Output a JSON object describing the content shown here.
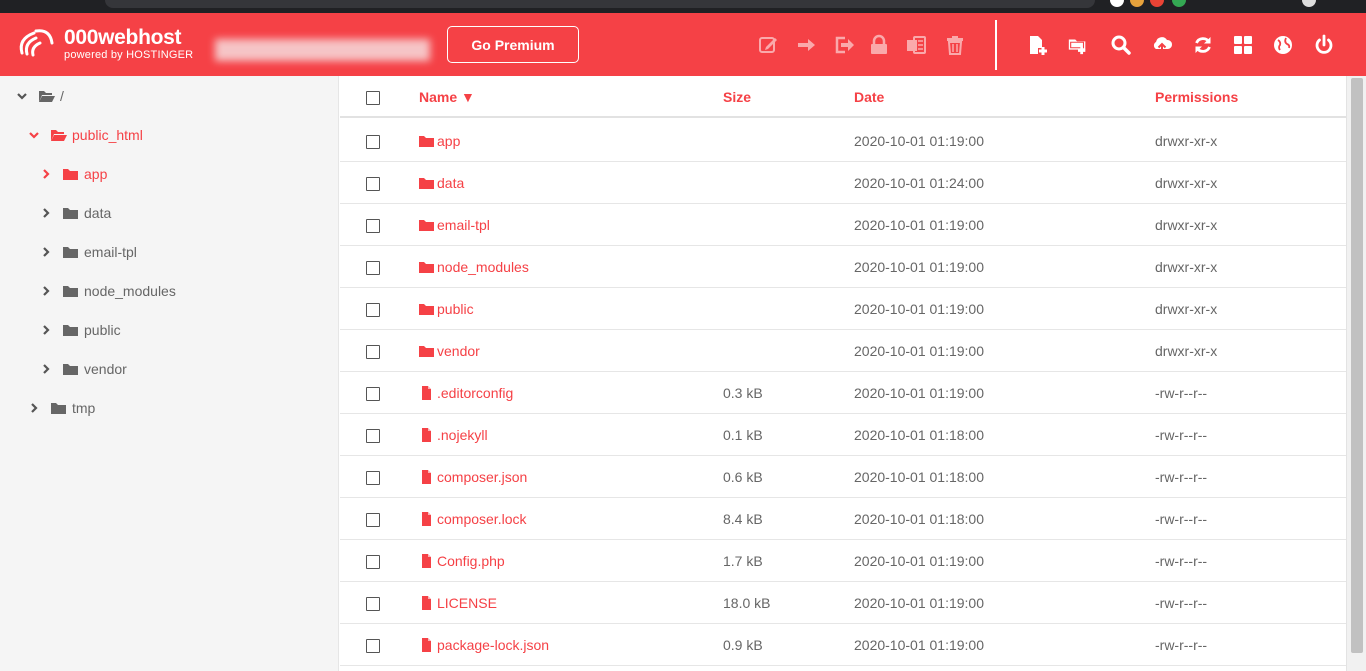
{
  "brand": {
    "name": "000webhost",
    "tagline": "powered by HOSTINGER"
  },
  "premium_button": "Go Premium",
  "toolbar": {
    "file_actions": [
      "edit-icon",
      "move-icon",
      "export-icon",
      "lock-icon",
      "archive-icon",
      "trash-icon"
    ],
    "global_actions": [
      "new-file-icon",
      "new-folder-icon",
      "search-icon",
      "upload-icon",
      "refresh-icon",
      "grid-view-icon",
      "globe-icon",
      "power-icon"
    ]
  },
  "tree": {
    "root": "/",
    "public_html": "public_html",
    "children": [
      "app",
      "data",
      "email-tpl",
      "node_modules",
      "public",
      "vendor"
    ],
    "tmp": "tmp"
  },
  "columns": {
    "name": "Name ▼",
    "size": "Size",
    "date": "Date",
    "permissions": "Permissions"
  },
  "files": [
    {
      "name": "app",
      "type": "folder",
      "size": "",
      "date": "2020-10-01 01:19:00",
      "perm": "drwxr-xr-x"
    },
    {
      "name": "data",
      "type": "folder",
      "size": "",
      "date": "2020-10-01 01:24:00",
      "perm": "drwxr-xr-x"
    },
    {
      "name": "email-tpl",
      "type": "folder",
      "size": "",
      "date": "2020-10-01 01:19:00",
      "perm": "drwxr-xr-x"
    },
    {
      "name": "node_modules",
      "type": "folder",
      "size": "",
      "date": "2020-10-01 01:19:00",
      "perm": "drwxr-xr-x"
    },
    {
      "name": "public",
      "type": "folder",
      "size": "",
      "date": "2020-10-01 01:19:00",
      "perm": "drwxr-xr-x"
    },
    {
      "name": "vendor",
      "type": "folder",
      "size": "",
      "date": "2020-10-01 01:19:00",
      "perm": "drwxr-xr-x"
    },
    {
      "name": ".editorconfig",
      "type": "file",
      "size": "0.3 kB",
      "date": "2020-10-01 01:19:00",
      "perm": "-rw-r--r--"
    },
    {
      "name": ".nojekyll",
      "type": "file",
      "size": "0.1 kB",
      "date": "2020-10-01 01:18:00",
      "perm": "-rw-r--r--"
    },
    {
      "name": "composer.json",
      "type": "file",
      "size": "0.6 kB",
      "date": "2020-10-01 01:18:00",
      "perm": "-rw-r--r--"
    },
    {
      "name": "composer.lock",
      "type": "file",
      "size": "8.4 kB",
      "date": "2020-10-01 01:18:00",
      "perm": "-rw-r--r--"
    },
    {
      "name": "Config.php",
      "type": "file",
      "size": "1.7 kB",
      "date": "2020-10-01 01:19:00",
      "perm": "-rw-r--r--"
    },
    {
      "name": "LICENSE",
      "type": "file",
      "size": "18.0 kB",
      "date": "2020-10-01 01:19:00",
      "perm": "-rw-r--r--"
    },
    {
      "name": "package-lock.json",
      "type": "file",
      "size": "0.9 kB",
      "date": "2020-10-01 01:19:00",
      "perm": "-rw-r--r--"
    }
  ],
  "colors": {
    "accent": "#f54146",
    "text": "#666666",
    "sidebar_bg": "#f5f5f5"
  }
}
